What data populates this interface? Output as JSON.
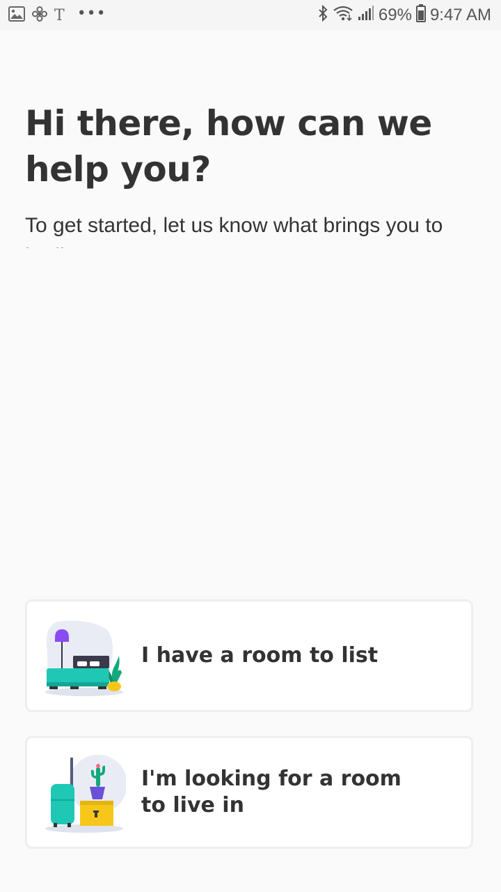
{
  "status_bar": {
    "battery": "69%",
    "time": "9:47 AM",
    "left_icons": [
      "gallery-icon",
      "fan-icon",
      "t-icon",
      "more-dots-icon"
    ],
    "right_icons": [
      "bluetooth-icon",
      "wifi-icon",
      "signal-icon",
      "battery-icon"
    ]
  },
  "header": {
    "title": "Hi there, how can we help you?",
    "subtitle": "To get started, let us know what brings you to badi"
  },
  "options": [
    {
      "label": "I have a room to list",
      "icon": "bedroom-illustration-icon"
    },
    {
      "label": "I'm looking for a room\nto live in",
      "icon": "moving-box-illustration-icon"
    }
  ],
  "colors": {
    "background": "#fafafa",
    "text": "#333333",
    "teal": "#1ec8b4",
    "purple": "#8a4bf2",
    "yellow": "#f6c71a",
    "card_border": "#eeeeee"
  }
}
